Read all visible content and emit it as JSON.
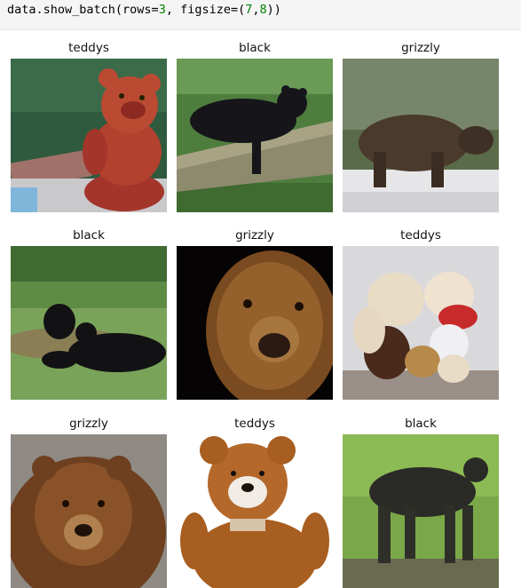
{
  "code": {
    "prefix": "data.show_batch(rows=",
    "rows": "3",
    "middle": ", figsize=(",
    "w": "7",
    "comma": ",",
    "h": "8",
    "suffix": "))"
  },
  "grid": [
    {
      "label": "teddys",
      "subject": "teddy-bear-photo"
    },
    {
      "label": "black",
      "subject": "black-bear-on-log-photo"
    },
    {
      "label": "grizzly",
      "subject": "grizzly-walking-photo"
    },
    {
      "label": "black",
      "subject": "black-bears-in-meadow-photo"
    },
    {
      "label": "grizzly",
      "subject": "grizzly-face-closeup-photo"
    },
    {
      "label": "teddys",
      "subject": "teddy-bear-pile-photo"
    },
    {
      "label": "grizzly",
      "subject": "grizzly-portrait-photo"
    },
    {
      "label": "teddys",
      "subject": "brown-teddy-bear-photo"
    },
    {
      "label": "black",
      "subject": "black-bear-walking-photo"
    }
  ]
}
